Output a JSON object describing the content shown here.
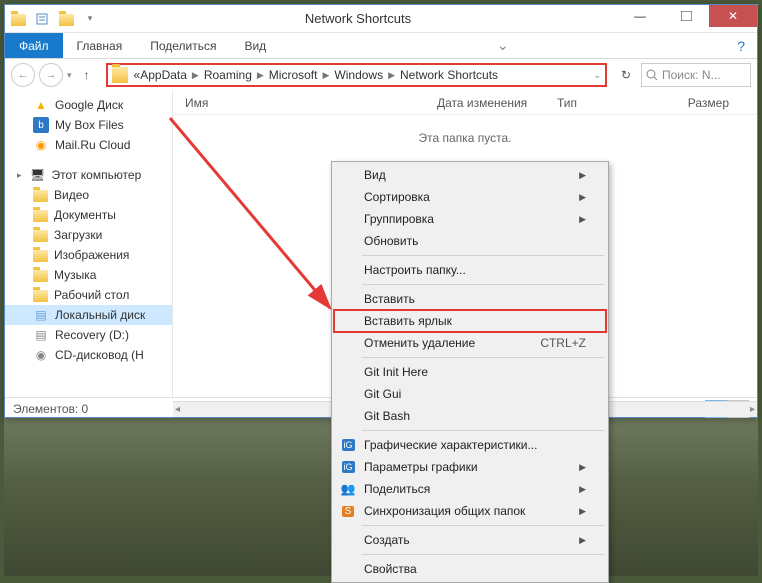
{
  "title": "Network Shortcuts",
  "ribbon": {
    "file": "Файл",
    "tabs": [
      "Главная",
      "Поделиться",
      "Вид"
    ]
  },
  "breadcrumb": {
    "prefix": "«",
    "parts": [
      "AppData",
      "Roaming",
      "Microsoft",
      "Windows",
      "Network Shortcuts"
    ]
  },
  "search": {
    "placeholder": "Поиск: N..."
  },
  "sidebar": {
    "fav": [
      {
        "label": "Google Диск",
        "icon": "gdrive"
      },
      {
        "label": "My Box Files",
        "icon": "box"
      },
      {
        "label": "Mail.Ru Cloud",
        "icon": "mailru"
      }
    ],
    "pc_label": "Этот компьютер",
    "pc": [
      {
        "label": "Видео",
        "icon": "folder"
      },
      {
        "label": "Документы",
        "icon": "folder"
      },
      {
        "label": "Загрузки",
        "icon": "folder"
      },
      {
        "label": "Изображения",
        "icon": "folder"
      },
      {
        "label": "Музыка",
        "icon": "folder"
      },
      {
        "label": "Рабочий стол",
        "icon": "folder"
      },
      {
        "label": "Локальный диск",
        "icon": "drive",
        "sel": true
      },
      {
        "label": "Recovery (D:)",
        "icon": "drive"
      },
      {
        "label": "CD-дисковод (H",
        "icon": "cd"
      }
    ]
  },
  "columns": [
    "Имя",
    "Дата изменения",
    "Тип",
    "Размер"
  ],
  "empty": "Эта папка пуста.",
  "status": "Элементов: 0",
  "ctx": {
    "groups": [
      [
        {
          "label": "Вид",
          "sub": true
        },
        {
          "label": "Сортировка",
          "sub": true
        },
        {
          "label": "Группировка",
          "sub": true
        },
        {
          "label": "Обновить"
        }
      ],
      [
        {
          "label": "Настроить папку..."
        }
      ],
      [
        {
          "label": "Вставить"
        },
        {
          "label": "Вставить ярлык",
          "hl": true
        },
        {
          "label": "Отменить удаление",
          "shortcut": "CTRL+Z"
        }
      ],
      [
        {
          "label": "Git Init Here"
        },
        {
          "label": "Git Gui"
        },
        {
          "label": "Git Bash"
        }
      ],
      [
        {
          "label": "Графические характеристики...",
          "icon": "intel"
        },
        {
          "label": "Параметры графики",
          "icon": "intel",
          "sub": true
        },
        {
          "label": "Поделиться",
          "icon": "share",
          "sub": true
        },
        {
          "label": "Синхронизация общих папок",
          "icon": "sync",
          "sub": true
        }
      ],
      [
        {
          "label": "Создать",
          "sub": true
        }
      ],
      [
        {
          "label": "Свойства"
        }
      ]
    ]
  }
}
